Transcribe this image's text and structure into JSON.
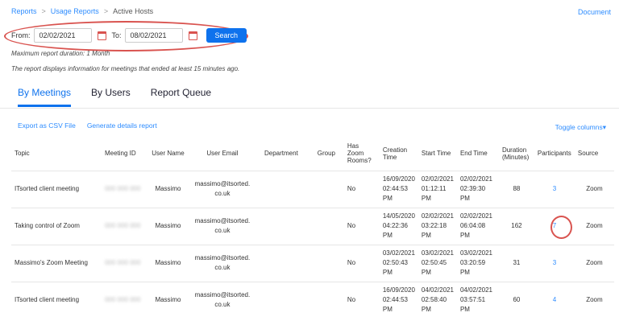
{
  "breadcrumb": {
    "items": [
      "Reports",
      "Usage Reports"
    ],
    "current": "Active Hosts",
    "separator": ">"
  },
  "doc_link": "Document",
  "date_filter": {
    "from_label": "From:",
    "from_value": "02/02/2021",
    "to_label": "To:",
    "to_value": "08/02/2021",
    "search_label": "Search"
  },
  "notes": {
    "max_duration": "Maximum report duration: 1 Month",
    "info": "The report displays information for meetings that ended at least 15 minutes ago."
  },
  "tabs": [
    {
      "label": "By Meetings"
    },
    {
      "label": "By Users"
    },
    {
      "label": "Report Queue"
    }
  ],
  "actions": {
    "export": "Export as CSV File",
    "generate": "Generate details report",
    "toggle": "Toggle columns▾"
  },
  "table": {
    "headers": [
      "Topic",
      "Meeting ID",
      "User Name",
      "User Email",
      "Department",
      "Group",
      "Has Zoom Rooms?",
      "Creation Time",
      "Start Time",
      "End Time",
      "Duration (Minutes)",
      "Participants",
      "Source"
    ],
    "rows": [
      {
        "topic": "ITsorted client meeting",
        "meeting_id": "000 000 000",
        "user_name": "Massimo",
        "email": "massimo@itsorted.co.uk",
        "department": "",
        "group": "",
        "zoom_rooms": "No",
        "creation": "16/09/2020 02:44:53 PM",
        "start": "02/02/2021 01:12:11 PM",
        "end": "02/02/2021 02:39:30 PM",
        "duration": "88",
        "participants": "3",
        "source": "Zoom"
      },
      {
        "topic": "Taking control of Zoom",
        "meeting_id": "000 000 000",
        "user_name": "Massimo",
        "email": "massimo@itsorted.co.uk",
        "department": "",
        "group": "",
        "zoom_rooms": "No",
        "creation": "14/05/2020 04:22:36 PM",
        "start": "02/02/2021 03:22:18 PM",
        "end": "02/02/2021 06:04:08 PM",
        "duration": "162",
        "participants": "7",
        "source": "Zoom"
      },
      {
        "topic": "Massimo's Zoom Meeting",
        "meeting_id": "000 000 000",
        "user_name": "Massimo",
        "email": "massimo@itsorted.co.uk",
        "department": "",
        "group": "",
        "zoom_rooms": "No",
        "creation": "03/02/2021 02:50:43 PM",
        "start": "03/02/2021 02:50:45 PM",
        "end": "03/02/2021 03:20:59 PM",
        "duration": "31",
        "participants": "3",
        "source": "Zoom"
      },
      {
        "topic": "ITsorted client meeting",
        "meeting_id": "000 000 000",
        "user_name": "Massimo",
        "email": "massimo@itsorted.co.uk",
        "department": "",
        "group": "",
        "zoom_rooms": "No",
        "creation": "16/09/2020 02:44:53 PM",
        "start": "04/02/2021 02:58:40 PM",
        "end": "04/02/2021 03:57:51 PM",
        "duration": "60",
        "participants": "4",
        "source": "Zoom"
      }
    ]
  },
  "colors": {
    "accent": "#0e72ed",
    "link": "#2d8cff",
    "highlight": "#d9534f"
  }
}
